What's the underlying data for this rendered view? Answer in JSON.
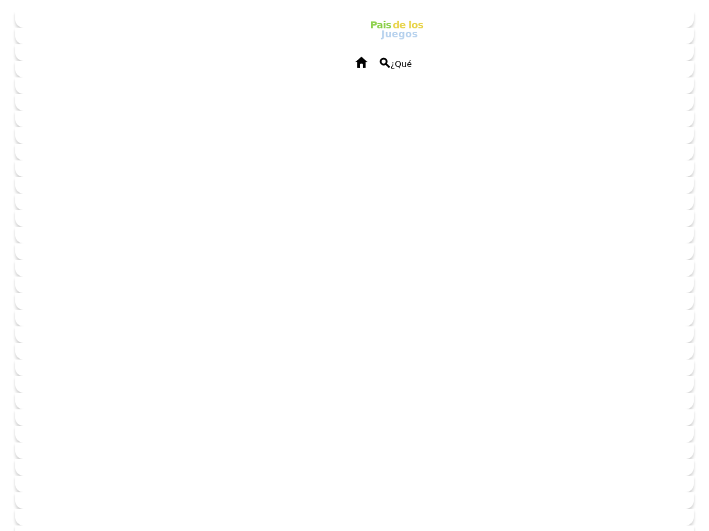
{
  "logo": {
    "parts": [
      {
        "text": "Pais",
        "color": "#8fd14f"
      },
      {
        "text": "de los",
        "color": "#e8d44d"
      },
      {
        "text": "Juegos",
        "color": "#b9d3ee"
      }
    ]
  },
  "nav": {
    "search_label": "¿Qué"
  }
}
